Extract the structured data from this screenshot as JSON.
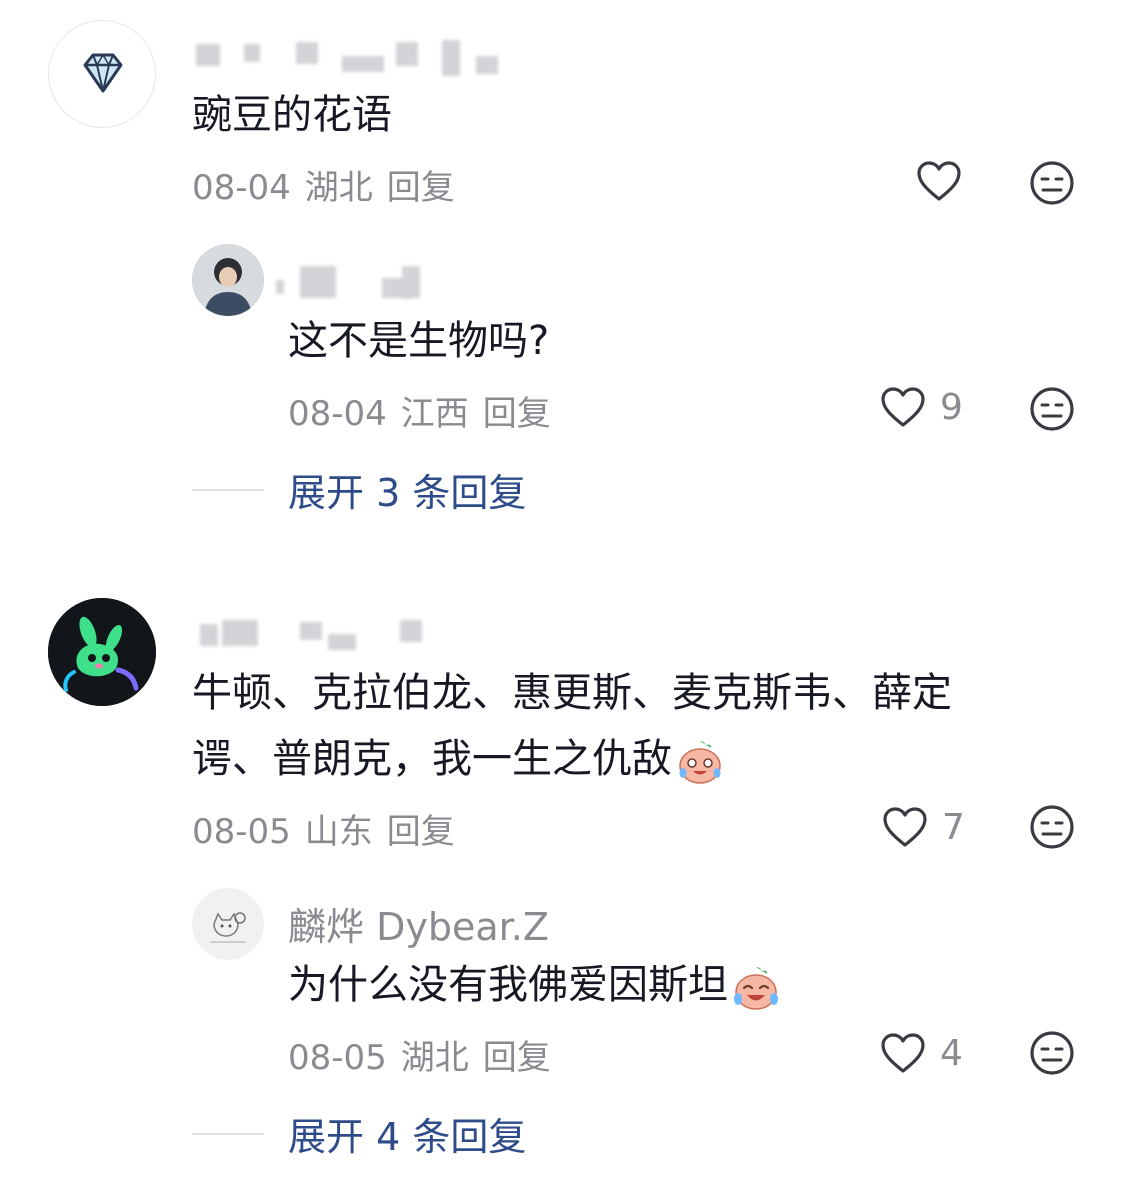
{
  "comments": [
    {
      "text": "豌豆的花语",
      "date": "08-04",
      "location": "湖北",
      "reply_label": "回复",
      "like_count": "",
      "replies": [
        {
          "text": "这不是生物吗?",
          "date": "08-04",
          "location": "江西",
          "reply_label": "回复",
          "like_count": "9"
        }
      ],
      "expand_label": "展开 3 条回复"
    },
    {
      "text_line1": "牛顿、克拉伯龙、惠更斯、麦克斯韦、薛定",
      "text_line2": "谔、普朗克，我一生之仇敌",
      "date": "08-05",
      "location": "山东",
      "reply_label": "回复",
      "like_count": "7",
      "replies": [
        {
          "username": "麟烨 Dybear.Z",
          "text": "为什么没有我佛爱因斯坦",
          "date": "08-05",
          "location": "湖北",
          "reply_label": "回复",
          "like_count": "4"
        }
      ],
      "expand_label": "展开 4 条回复"
    }
  ],
  "icons": {
    "like": "heart-outline-icon",
    "dislike": "neutral-face-icon",
    "emoji": "crying-laughing-emoji"
  },
  "colors": {
    "text": "#161823",
    "secondary": "#8a8b91",
    "expand_link": "#2f4c8a"
  }
}
